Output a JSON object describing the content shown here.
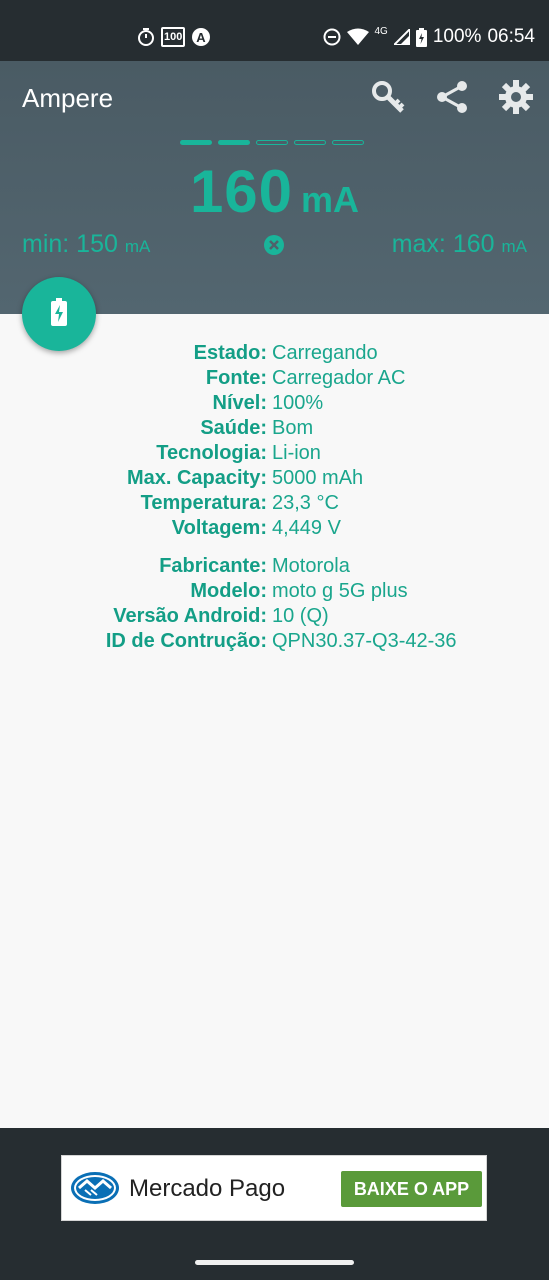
{
  "status_bar": {
    "battery_text": "100%",
    "time": "06:54",
    "network": "4G",
    "notif_badge": "100",
    "icons": [
      "stopwatch-icon",
      "calendar-100-icon",
      "a-badge-icon",
      "dnd-icon",
      "wifi-icon",
      "cell-signal-icon",
      "battery-charging-icon"
    ]
  },
  "app": {
    "title": "Ampere",
    "actions": [
      "key-icon",
      "share-icon",
      "settings-icon"
    ]
  },
  "pager": {
    "total": 5,
    "filled": 2
  },
  "current": {
    "value": "160",
    "unit": "mA"
  },
  "min": {
    "label": "min: 150",
    "unit": "mA"
  },
  "max": {
    "label": "max: 160",
    "unit": "mA"
  },
  "info": {
    "battery": [
      {
        "label": "Estado:",
        "value": "Carregando"
      },
      {
        "label": "Fonte:",
        "value": "Carregador AC"
      },
      {
        "label": "Nível:",
        "value": "100%"
      },
      {
        "label": "Saúde:",
        "value": "Bom"
      },
      {
        "label": "Tecnologia:",
        "value": "Li-ion"
      },
      {
        "label": "Max. Capacity:",
        "value": "5000 mAh"
      },
      {
        "label": "Temperatura:",
        "value": "23,3 °C"
      },
      {
        "label": "Voltagem:",
        "value": "4,449 V"
      }
    ],
    "device": [
      {
        "label": "Fabricante:",
        "value": "Motorola"
      },
      {
        "label": "Modelo:",
        "value": "moto g 5G plus"
      },
      {
        "label": "Versão Android:",
        "value": "10 (Q)"
      },
      {
        "label": "ID de Contrução:",
        "value": "QPN30.37-Q3-42-36"
      }
    ]
  },
  "ad": {
    "brand": "Mercado Pago",
    "cta": "BAIXE O APP"
  },
  "colors": {
    "accent": "#19b59a",
    "header": "#4f616a",
    "statusbar": "#262d31",
    "ad_button": "#5a9a3a"
  }
}
